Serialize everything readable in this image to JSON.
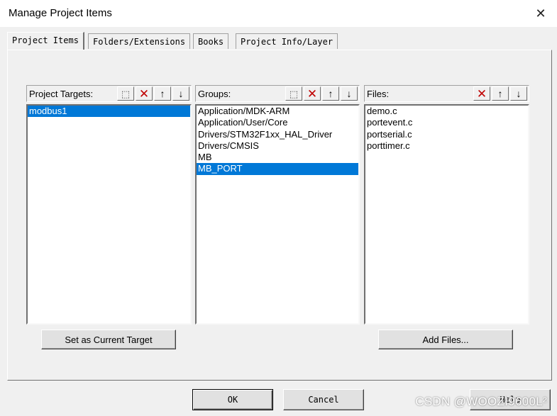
{
  "window": {
    "title": "Manage Project Items",
    "close_glyph": "✕"
  },
  "tabs": [
    {
      "label": "Project Items",
      "active": true
    },
    {
      "label": "Folders/Extensions",
      "active": false
    },
    {
      "label": "Books",
      "active": false
    },
    {
      "label": "Project Info/Layer",
      "active": false
    }
  ],
  "targets": {
    "header": "Project Targets:",
    "items": [
      "modbus1"
    ],
    "selected_index": 0,
    "button_label": "Set as Current Target"
  },
  "groups": {
    "header": "Groups:",
    "items": [
      "Application/MDK-ARM",
      "Application/User/Core",
      "Drivers/STM32F1xx_HAL_Driver",
      "Drivers/CMSIS",
      "MB",
      "MB_PORT"
    ],
    "selected_index": 5
  },
  "files": {
    "header": "Files:",
    "items": [
      "demo.c",
      "portevent.c",
      "portserial.c",
      "porttimer.c"
    ],
    "button_label": "Add Files..."
  },
  "toolbar_icons": {
    "new": "new-item-icon",
    "delete": "delete-icon",
    "up": "move-up-icon",
    "down": "move-down-icon"
  },
  "footer": {
    "ok": "OK",
    "cancel": "Cancel",
    "help": "Help"
  },
  "watermark": "CSDN @WOOZI9600L²",
  "colors": {
    "selection": "#0078d7",
    "delete_icon": "#c00000",
    "dialog_bg": "#f0f0f0"
  }
}
